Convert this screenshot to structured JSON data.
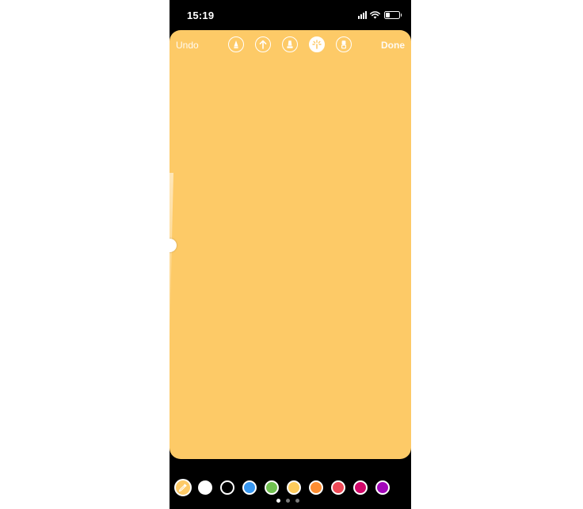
{
  "status_bar": {
    "time": "15:19",
    "signal_bars": 4,
    "battery_level": 0.35
  },
  "editor": {
    "canvas_color": "#FDCA67",
    "undo_label": "Undo",
    "done_label": "Done",
    "brush_tools": [
      {
        "name": "pen-icon",
        "selected": false
      },
      {
        "name": "arrow-icon",
        "selected": false
      },
      {
        "name": "marker-icon",
        "selected": false
      },
      {
        "name": "neon-icon",
        "selected": true
      },
      {
        "name": "eraser-icon",
        "selected": false
      }
    ],
    "brush_size": 0.3
  },
  "palette": {
    "eyedropper_icon": "eyedropper-icon",
    "eyedropper_color": "#FDCA67",
    "colors": [
      {
        "name": "white",
        "hex": "#FFFFFF"
      },
      {
        "name": "black",
        "hex": "#000000"
      },
      {
        "name": "blue",
        "hex": "#3897F0"
      },
      {
        "name": "green",
        "hex": "#70C050"
      },
      {
        "name": "yellow",
        "hex": "#FDCB5C"
      },
      {
        "name": "orange",
        "hex": "#FD8D32"
      },
      {
        "name": "red",
        "hex": "#ED4956"
      },
      {
        "name": "pink",
        "hex": "#D10869"
      },
      {
        "name": "purple",
        "hex": "#A307BA"
      }
    ]
  },
  "pagination": {
    "pages": 3,
    "current": 0
  }
}
